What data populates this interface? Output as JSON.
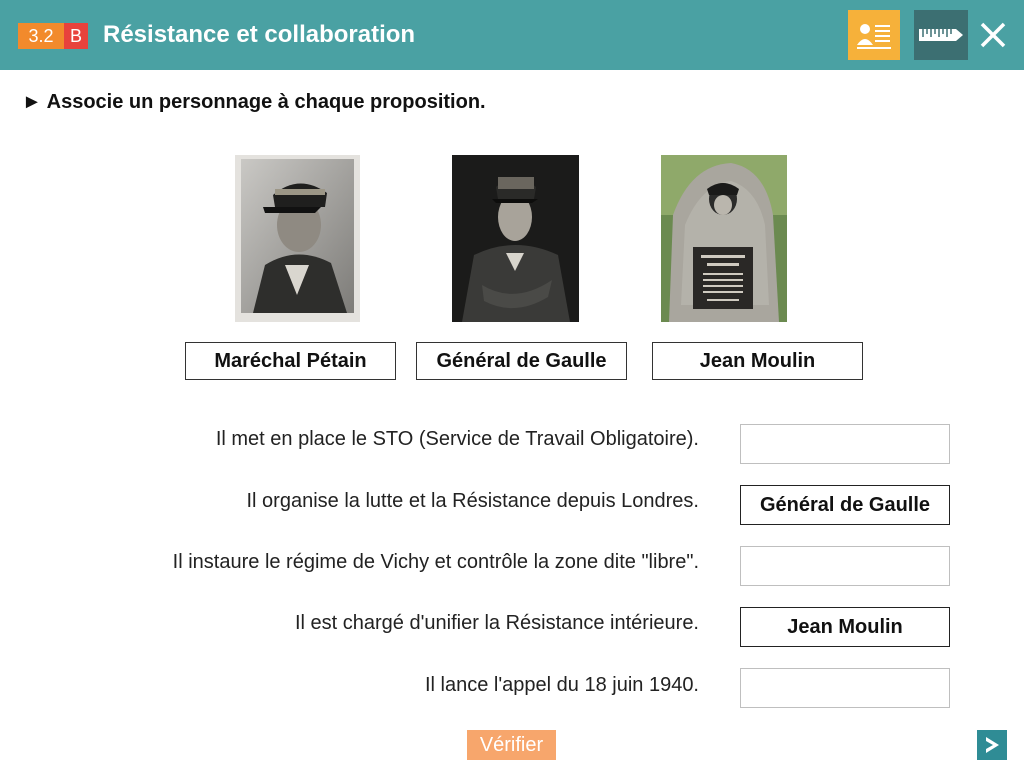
{
  "header": {
    "badge_number": "3.2",
    "badge_letter": "B",
    "title": "Résistance et collaboration",
    "colors": {
      "bar": "#4aa1a3",
      "badge_number": "#f28a2c",
      "badge_letter": "#e8423c",
      "profile_button": "#f6b13a",
      "tool_button": "#3c6f72"
    },
    "icons": [
      "profile-card-icon",
      "ruler-icon",
      "close-icon"
    ]
  },
  "instruction": "Associe un personnage à chaque proposition.",
  "photos": [
    "photo-petain",
    "photo-de-gaulle",
    "photo-moulin-memorial"
  ],
  "characters": [
    {
      "label": "Maréchal Pétain"
    },
    {
      "label": "Général de Gaulle"
    },
    {
      "label": "Jean Moulin"
    }
  ],
  "propositions": [
    {
      "text": "Il met en place le STO (Service de Travail Obligatoire).",
      "answer": ""
    },
    {
      "text": "Il organise la lutte et la Résistance depuis Londres.",
      "answer": "Général de Gaulle"
    },
    {
      "text": "Il instaure le régime de Vichy et contrôle la zone dite \"libre\".",
      "answer": ""
    },
    {
      "text": "Il est chargé d'unifier la Résistance intérieure.",
      "answer": "Jean Moulin"
    },
    {
      "text": "Il lance l'appel du 18 juin 1940.",
      "answer": ""
    }
  ],
  "footer": {
    "verify_label": "Vérifier",
    "verify_color": "#f7a66c",
    "next_color": "#2f8c95"
  }
}
